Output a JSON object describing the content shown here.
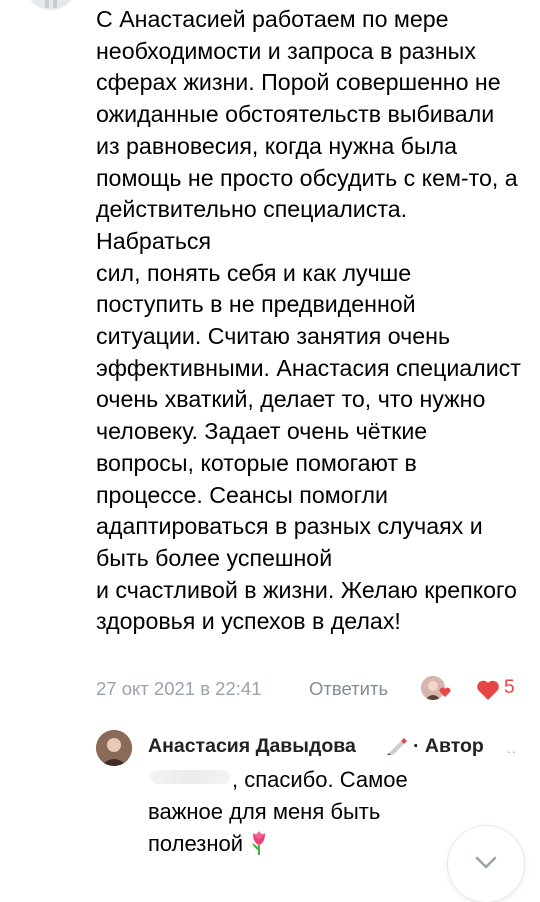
{
  "comment": {
    "text": "С Анастасией работаем по мере необходимости и запроса в разных сферах жизни. Порой совершенно не ожиданные обстоятельств выбивали из равновесия, когда нужна была помощь не просто обсудить с кем-то, а действительно специалиста. Набраться\nсил, понять себя и как лучше поступить в не предвиденной ситуации. Считаю занятия очень эффективными. Анастасия специалист очень хваткий, делает то, что нужно человеку. Задает очень чёткие вопросы, которые помогают в процессе. Сеансы помогли адаптироваться в разных случаях и быть более успешной\nи счастливой в жизни. Желаю крепкого здоровья и успехов в делах!",
    "timestamp": "27 окт 2021 в 22:41",
    "reply_label": "Ответить",
    "like_count": "5",
    "icons": {
      "avatar": "user-avatar-icon",
      "author_like": "author-liked-icon",
      "like": "heart-icon"
    }
  },
  "reply": {
    "author_name": "Анастасия Давыдова",
    "author_badge": "· Автор",
    "more": "..",
    "text": ", спасибо. Самое важное для меня быть полезной",
    "icons": {
      "badge": "pen-icon",
      "emoji": "tulip-icon",
      "scroll": "chevron-down-icon"
    }
  },
  "colors": {
    "text": "#000000",
    "meta": "#99a2ad",
    "like": "#e64646"
  }
}
